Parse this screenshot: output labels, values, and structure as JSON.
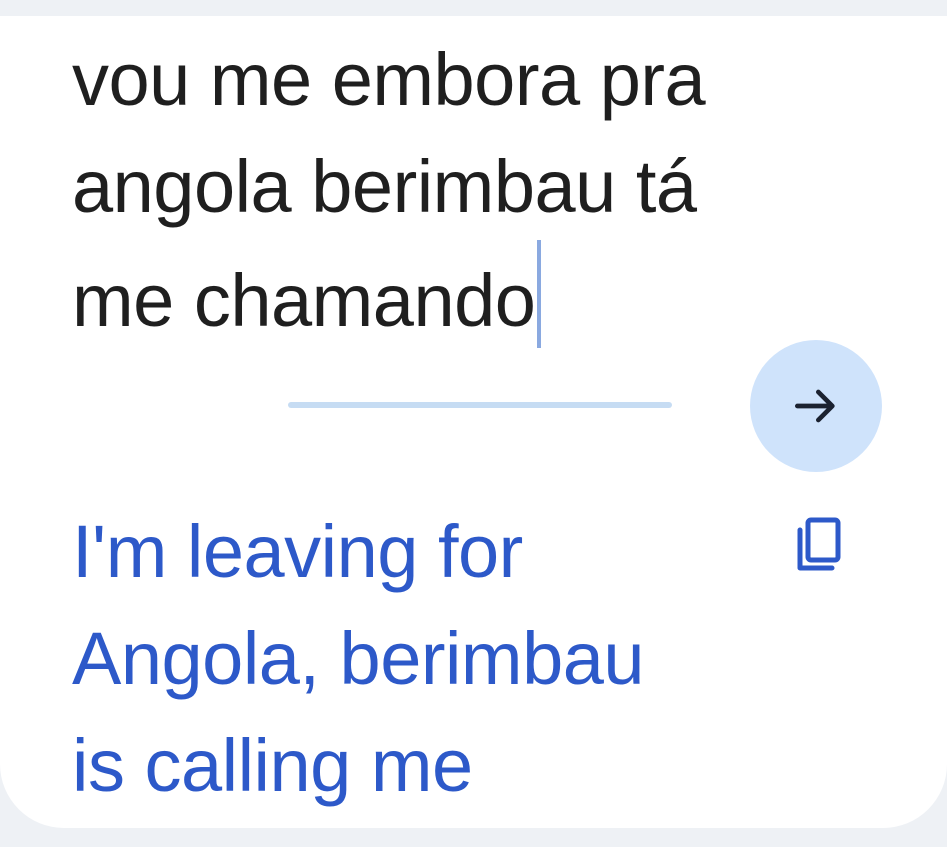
{
  "source": {
    "lines": [
      "vou me embora pra",
      "angola berimbau tá",
      "me chamando"
    ]
  },
  "translate_button": {
    "icon": "arrow-right-icon"
  },
  "translation": {
    "lines": [
      "I'm leaving for",
      "Angola, berimbau",
      "is calling me"
    ]
  },
  "copy_button": {
    "icon": "copy-icon"
  },
  "colors": {
    "page_background": "#eef1f5",
    "card_background": "#ffffff",
    "source_text": "#1f1f1f",
    "translation_text": "#2d59c9",
    "accent_light": "#cfe3fb",
    "progress_track": "#c6dcf3",
    "caret": "#8aa9e0",
    "icon_dark": "#1b2230"
  }
}
